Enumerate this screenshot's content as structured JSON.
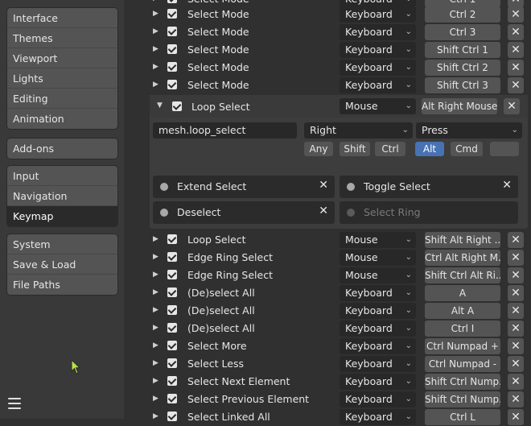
{
  "sidebar": {
    "group1": [
      "Interface",
      "Themes",
      "Viewport",
      "Lights",
      "Editing",
      "Animation"
    ],
    "group2": [
      "Add-ons"
    ],
    "group3": [
      "Input",
      "Navigation",
      "Keymap"
    ],
    "group4": [
      "System",
      "Save & Load",
      "File Paths"
    ],
    "active": "Keymap"
  },
  "rows_top": [
    {
      "name": "Select Mode",
      "type": "Keyboard",
      "key": "Ctrl 2"
    },
    {
      "name": "Select Mode",
      "type": "Keyboard",
      "key": "Ctrl 3"
    },
    {
      "name": "Select Mode",
      "type": "Keyboard",
      "key": "Shift Ctrl 1"
    },
    {
      "name": "Select Mode",
      "type": "Keyboard",
      "key": "Shift Ctrl 2"
    },
    {
      "name": "Select Mode",
      "type": "Keyboard",
      "key": "Shift Ctrl 3"
    }
  ],
  "expanded": {
    "name": "Loop Select",
    "type": "Mouse",
    "key": "Alt Right Mouse",
    "operator": "mesh.loop_select",
    "button": "Right",
    "action": "Press",
    "modifiers": [
      "Any",
      "Shift",
      "Ctrl",
      "Alt",
      "Cmd"
    ],
    "active_modifier": "Alt",
    "props": [
      {
        "label": "Extend Select",
        "enabled": true
      },
      {
        "label": "Toggle Select",
        "enabled": true
      },
      {
        "label": "Deselect",
        "enabled": true
      },
      {
        "label": "Select Ring",
        "enabled": false
      }
    ]
  },
  "rows_bottom": [
    {
      "name": "Loop Select",
      "type": "Mouse",
      "key": "Shift Alt Right ..."
    },
    {
      "name": "Edge Ring Select",
      "type": "Mouse",
      "key": "Ctrl Alt Right M..."
    },
    {
      "name": "Edge Ring Select",
      "type": "Mouse",
      "key": "Shift Ctrl Alt Ri..."
    },
    {
      "name": "(De)select All",
      "type": "Keyboard",
      "key": "A"
    },
    {
      "name": "(De)select All",
      "type": "Keyboard",
      "key": "Alt A"
    },
    {
      "name": "(De)select All",
      "type": "Keyboard",
      "key": "Ctrl I"
    },
    {
      "name": "Select More",
      "type": "Keyboard",
      "key": "Ctrl Numpad +"
    },
    {
      "name": "Select Less",
      "type": "Keyboard",
      "key": "Ctrl Numpad -"
    },
    {
      "name": "Select Next Element",
      "type": "Keyboard",
      "key": "Shift Ctrl Nump..."
    },
    {
      "name": "Select Previous Element",
      "type": "Keyboard",
      "key": "Shift Ctrl Nump..."
    },
    {
      "name": "Select Linked All",
      "type": "Keyboard",
      "key": "Ctrl L"
    }
  ],
  "icons": {
    "expand": "triangle-right-icon",
    "collapse": "triangle-down-icon",
    "remove": "close-icon",
    "menu": "hamburger-icon"
  },
  "colors": {
    "accent": "#4772b3",
    "background": "#303030",
    "sidebar": "#393939"
  }
}
